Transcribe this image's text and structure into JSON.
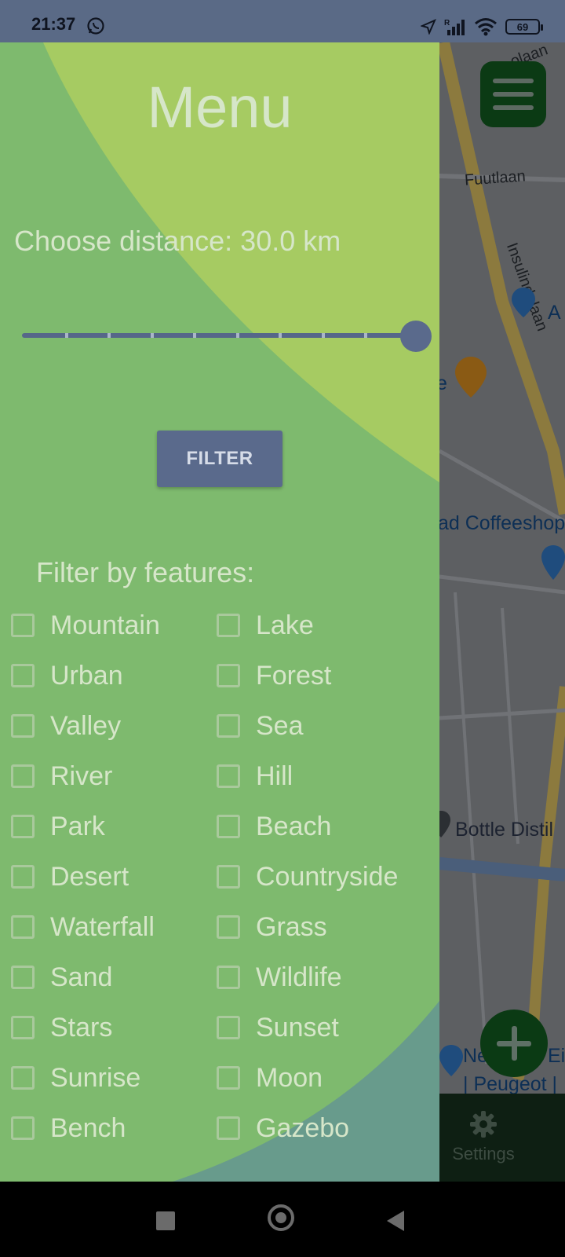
{
  "status_bar": {
    "time": "21:37",
    "battery": "69",
    "icons": [
      "whatsapp-icon",
      "location-arrow-icon",
      "signal-icon",
      "wifi-icon",
      "battery-icon"
    ]
  },
  "map": {
    "labels": {
      "top_road": "olaan",
      "futlaan": "Fuutlaan",
      "insulindelaan": "Insulindelaan",
      "poi_a": "A",
      "restaurant_fragment": "e",
      "coffeeshop": "ad Coffeeshop",
      "bottle": "Bottle Distil",
      "peugeot_line1": "Ne",
      "peugeot_line1b": "Ei",
      "peugeot_line2": "| Peugeot |"
    },
    "bottom_tab": {
      "label": "Settings",
      "icon": "gear-icon"
    }
  },
  "drawer": {
    "title": "Menu",
    "distance_label": "Choose distance: 30.0 km",
    "slider": {
      "value_km": 30.0,
      "min": 0,
      "max": 30,
      "ticks": 10
    },
    "filter_button": "FILTER",
    "features_label": "Filter by features:",
    "features_left": [
      "Mountain",
      "Urban",
      "Valley",
      "River",
      "Park",
      "Desert",
      "Waterfall",
      "Sand",
      "Stars",
      "Sunrise",
      "Bench"
    ],
    "features_right": [
      "Lake",
      "Forest",
      "Sea",
      "Hill",
      "Beach",
      "Countryside",
      "Grass",
      "Wildlife",
      "Sunset",
      "Moon",
      "Gazebo"
    ]
  },
  "colors": {
    "drawer_green": "#7eba6e",
    "drawer_yellow_green": "#a8cb63",
    "drawer_blue": "#6a9a8a",
    "accent_slate": "#5a6a8c",
    "scrim_text": "#d6e6c9",
    "fab_green": "#0b3a14"
  }
}
